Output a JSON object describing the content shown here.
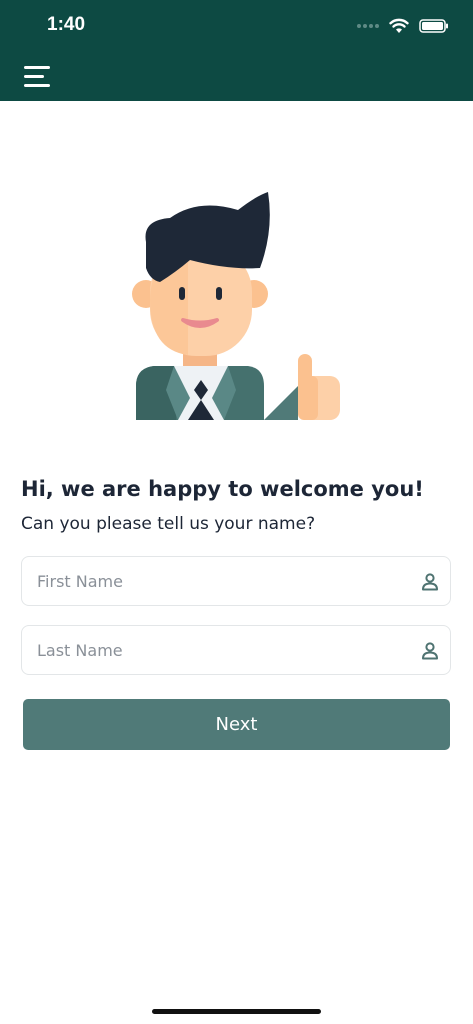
{
  "status_bar": {
    "time": "1:40"
  },
  "header": {
    "menu_icon": "hamburger-menu-icon",
    "background": "#0d4a43"
  },
  "illustration": {
    "name": "welcome-man-thumbs-up"
  },
  "main": {
    "heading": "Hi, we are happy to welcome you!",
    "subheading": "Can you please tell us your name?"
  },
  "form": {
    "first_name": {
      "placeholder": "First Name",
      "value": "",
      "icon": "person-icon"
    },
    "last_name": {
      "placeholder": "Last Name",
      "value": "",
      "icon": "person-icon"
    },
    "next_label": "Next"
  },
  "colors": {
    "accent": "#507a78",
    "header": "#0d4a43",
    "text": "#1d2636"
  }
}
